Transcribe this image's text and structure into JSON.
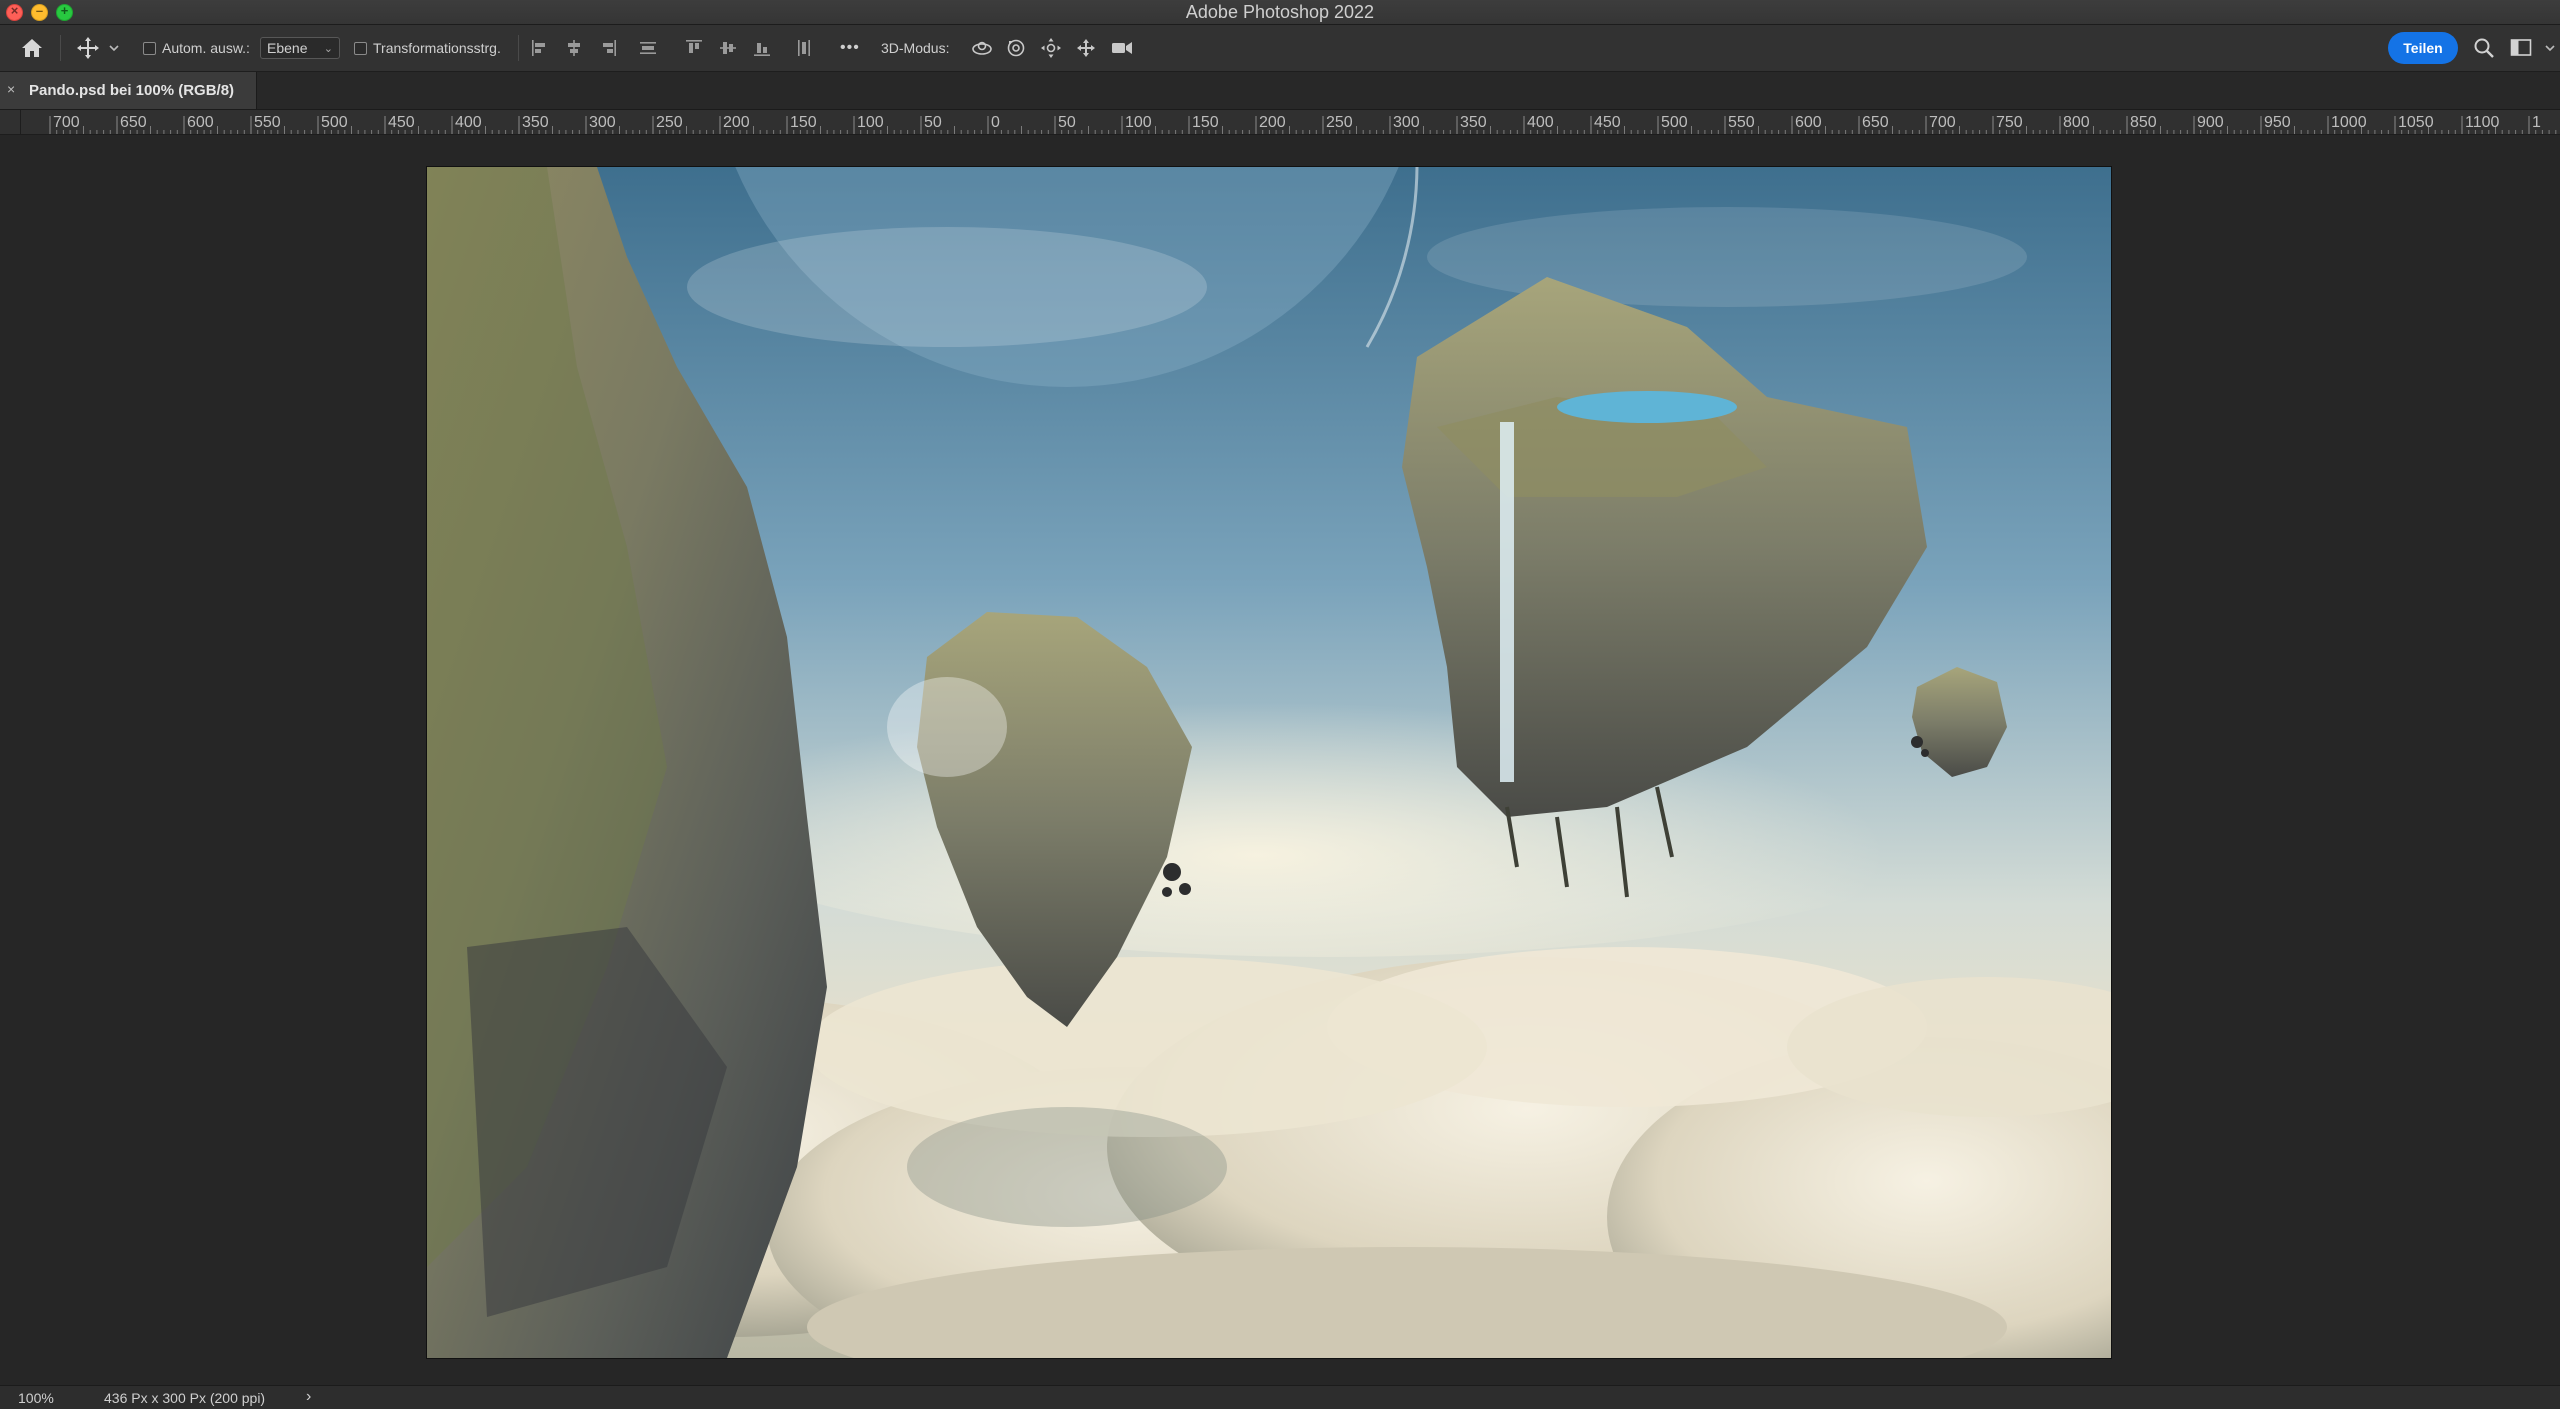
{
  "window": {
    "title": "Adobe Photoshop 2022"
  },
  "options_bar": {
    "auto_select_label": "Autom. ausw.:",
    "auto_select_target": "Ebene",
    "transform_controls_label": "Transformationsstrg.",
    "more_label": "•••",
    "mode_3d_label": "3D-Modus:",
    "share_label": "Teilen"
  },
  "document_tab": {
    "close_glyph": "×",
    "label": "Pando.psd bei 100% (RGB/8)"
  },
  "ruler": {
    "labels": [
      "700",
      "650",
      "600",
      "550",
      "500",
      "450",
      "400",
      "350",
      "300",
      "250",
      "200",
      "150",
      "100",
      "50",
      "0",
      "50",
      "100",
      "150",
      "200",
      "250",
      "300",
      "350",
      "400",
      "450",
      "500",
      "550",
      "600",
      "650",
      "700",
      "750",
      "800",
      "850",
      "900",
      "950",
      "1000",
      "1050",
      "1100",
      "1"
    ]
  },
  "status_bar": {
    "zoom": "100%",
    "document_info": "436 Px x 300 Px (200 ppi)",
    "arrow": "›"
  },
  "colors": {
    "accent": "#1473e6",
    "close": "#fe5f57",
    "minimize": "#febc2e",
    "maximize": "#28c840"
  },
  "icons": {
    "home": "home-icon",
    "move": "move-tool-icon",
    "search": "search-icon",
    "workspace": "workspace-icon"
  }
}
